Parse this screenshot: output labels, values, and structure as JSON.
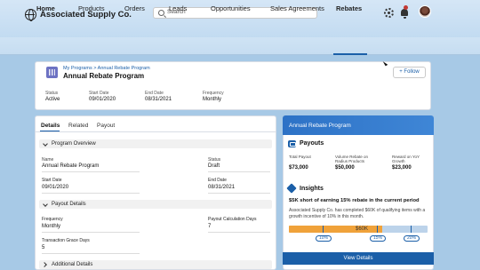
{
  "app": {
    "brand": "Associated Supply Co."
  },
  "search": {
    "placeholder": "Search"
  },
  "nav": {
    "items": [
      {
        "label": "Home"
      },
      {
        "label": "Products"
      },
      {
        "label": "Orders"
      },
      {
        "label": "Leads"
      },
      {
        "label": "Opportunities"
      },
      {
        "label": "Sales Agreements"
      },
      {
        "label": "Rebates"
      }
    ],
    "active": "Rebates"
  },
  "record": {
    "breadcrumb": "My Programs > Annual Rebate Program",
    "title": "Annual Rebate Program",
    "follow_label": "+ Follow",
    "fields": [
      {
        "label": "Status",
        "value": "Active"
      },
      {
        "label": "Start Date",
        "value": "09/01/2020"
      },
      {
        "label": "End Date",
        "value": "08/31/2021"
      },
      {
        "label": "Frequency",
        "value": "Monthly"
      }
    ]
  },
  "tabs": [
    {
      "label": "Details"
    },
    {
      "label": "Related"
    },
    {
      "label": "Payout"
    }
  ],
  "details": {
    "program_overview": {
      "header": "Program Overview",
      "name_label": "Name",
      "name_value": "Annual Rebate Program",
      "status_label": "Status",
      "status_value": "Draft",
      "start_label": "Start Date",
      "start_value": "09/01/2020",
      "end_label": "End Date",
      "end_value": "08/31/2021"
    },
    "payout_details": {
      "header": "Payout Details",
      "frequency_label": "Frequency",
      "frequency_value": "Monthly",
      "calc_days_label": "Payout Calculation Days",
      "calc_days_value": "7",
      "grace_label": "Transaction Grace Days",
      "grace_value": "5"
    },
    "additional": {
      "header": "Additional Details"
    }
  },
  "program_card": {
    "title": "Annual Rebate Program",
    "payouts": {
      "heading": "Payouts",
      "total_label": "Total Payout",
      "total_value": "$73,000",
      "volume_label": "Volume Rebate on Radius Products",
      "volume_value": "$50,000",
      "reward_label": "Reward on YoY Growth",
      "reward_value": "$23,000"
    },
    "insights": {
      "heading": "Insights",
      "headline": "$5K short of earning 15% rebate in the current period",
      "body": "Associated Supply Co. has completed $60K of qualifying items with a growth incentive of 10% in this month.",
      "progress_label": "$60K",
      "progress_fraction": 0.67,
      "ticks": [
        "10%",
        "15%",
        "20%"
      ]
    },
    "view_details_label": "View Details"
  },
  "colors": {
    "brand_blue": "#1b5fa8",
    "progress_orange": "#f0a23a",
    "record_icon": "#6d72c3",
    "notification": "#c23934"
  },
  "icons": [
    "globe-logo-icon",
    "search-icon",
    "gear-icon",
    "bell-icon",
    "record-icon",
    "chevron-down-icon",
    "payouts-icon",
    "insights-icon"
  ]
}
